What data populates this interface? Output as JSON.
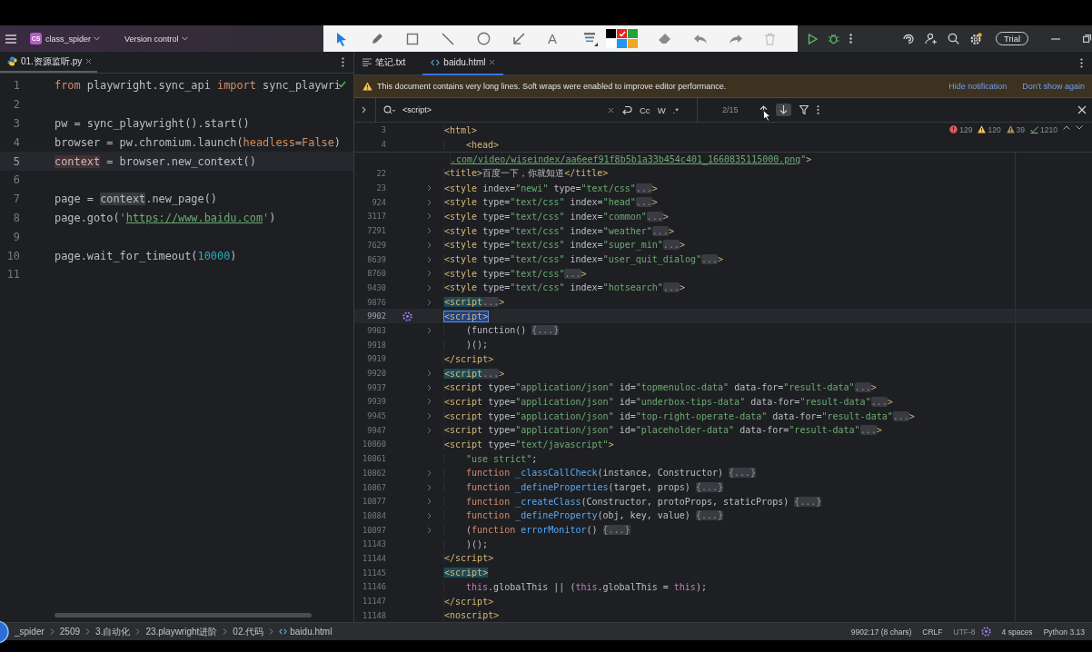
{
  "title_bar": {
    "project_badge": "CS",
    "project": "class_spider",
    "vcs": "Version control",
    "trial": "Trial"
  },
  "annotation_toolbar": {
    "tools": [
      {
        "kind": "pointer",
        "selected": true
      },
      {
        "kind": "pencil",
        "selected": false
      },
      {
        "kind": "rectangle",
        "selected": false
      },
      {
        "kind": "line",
        "selected": false
      },
      {
        "kind": "ellipse",
        "selected": false
      },
      {
        "kind": "arrow",
        "selected": false
      },
      {
        "kind": "text",
        "label": "A",
        "selected": false
      },
      {
        "kind": "stroke",
        "selected": false
      }
    ],
    "palette": [
      {
        "color": "#000000",
        "selected": false
      },
      {
        "color": "#e8231f",
        "selected": true
      },
      {
        "color": "#1fa53a",
        "selected": false
      },
      {
        "color": "#ffffff",
        "selected": false
      },
      {
        "color": "#2196f3",
        "selected": false
      },
      {
        "color": "#f5a623",
        "selected": false
      }
    ],
    "actions": [
      {
        "kind": "eraser",
        "disabled": false
      },
      {
        "kind": "undo",
        "disabled": false
      },
      {
        "kind": "redo",
        "disabled": false
      },
      {
        "kind": "delete",
        "disabled": true
      }
    ]
  },
  "left_editor": {
    "tabs": [
      {
        "label": "01.资源监听.py",
        "selected": true
      }
    ],
    "lines": [
      {
        "number": "1",
        "current": false,
        "tokens": [
          {
            "kind": "kw",
            "text": "from"
          },
          {
            "kind": "plain",
            "text": " playwright.sync_api "
          },
          {
            "kind": "kw",
            "text": "import"
          },
          {
            "kind": "plain",
            "text": " sync_playwri"
          }
        ]
      },
      {
        "number": "2",
        "current": false
      },
      {
        "number": "3",
        "current": false,
        "tokens": [
          {
            "kind": "plain",
            "text": "pw = sync_playwright().start()"
          }
        ]
      },
      {
        "number": "4",
        "current": false,
        "tokens": [
          {
            "kind": "plain",
            "text": "browser = pw.chromium.launch("
          },
          {
            "kind": "param",
            "text": "headless"
          },
          {
            "kind": "plain",
            "text": "="
          },
          {
            "kind": "kw",
            "text": "False"
          },
          {
            "kind": "plain",
            "text": ")"
          }
        ]
      },
      {
        "number": "5",
        "current": true,
        "tokens": [
          {
            "kind": "write",
            "text": "context"
          },
          {
            "kind": "plain",
            "text": " = browser.new_context()"
          }
        ]
      },
      {
        "number": "6",
        "current": false
      },
      {
        "number": "7",
        "current": false,
        "tokens": [
          {
            "kind": "plain",
            "text": "page = "
          },
          {
            "kind": "read",
            "text": "context"
          },
          {
            "kind": "plain",
            "text": ".new_page()"
          }
        ]
      },
      {
        "number": "8",
        "current": false,
        "tokens": [
          {
            "kind": "plain",
            "text": "page.goto("
          },
          {
            "kind": "str",
            "text": "'"
          },
          {
            "kind": "url",
            "text": "https://www.baidu.com"
          },
          {
            "kind": "str",
            "text": "'"
          },
          {
            "kind": "plain",
            "text": ")"
          }
        ]
      },
      {
        "number": "9",
        "current": false
      },
      {
        "number": "10",
        "current": false,
        "tokens": [
          {
            "kind": "plain",
            "text": "page.wait_for_timeout("
          },
          {
            "kind": "num",
            "text": "10000"
          },
          {
            "kind": "plain",
            "text": ")"
          }
        ]
      },
      {
        "number": "11",
        "current": false
      }
    ]
  },
  "right_editor": {
    "tabs": [
      {
        "label": "笔记.txt",
        "kind": "text",
        "selected": false
      },
      {
        "label": "baidu.html",
        "kind": "html",
        "selected": true
      }
    ],
    "notification": {
      "text": "This document contains very long lines. Soft wraps were enabled to improve editor performance.",
      "actions": [
        "Hide notification",
        "Don't show again"
      ]
    },
    "search": {
      "query": "<script>",
      "options": [
        "Cc",
        "W",
        ".*"
      ],
      "match_count": "2/15"
    },
    "inspections": [
      {
        "kind": "error",
        "count": "129"
      },
      {
        "kind": "warning",
        "count": "120"
      },
      {
        "kind": "weak",
        "count": "39"
      },
      {
        "kind": "typo",
        "count": "1210"
      }
    ],
    "sticky_lines": [
      {
        "number": "3",
        "current": false,
        "foldable": false,
        "marked": false,
        "tokens": [
          {
            "kind": "tag",
            "text": "<html>"
          }
        ],
        "children": [
          {
            "number": "4",
            "current": false,
            "foldable": false,
            "marked": false,
            "tokens": [
              {
                "kind": "tag",
                "text": "<head>"
              }
            ]
          }
        ]
      }
    ],
    "lines": [
      {
        "kind": "continuation",
        "current": false,
        "foldable": false,
        "marked": false,
        "tokens": [
          {
            "kind": "url",
            "text": ".com/video/wiseindex/aa6eef91f8b5b1a33b454c401_1660835115000.png"
          },
          {
            "kind": "val",
            "text": "\""
          },
          {
            "kind": "tag",
            "text": ">"
          }
        ]
      },
      {
        "number": "22",
        "current": false,
        "foldable": false,
        "marked": false,
        "tokens": [
          {
            "kind": "tag",
            "text": "<title>"
          },
          {
            "kind": "plain",
            "text": "百度一下，你就知道"
          },
          {
            "kind": "tag",
            "text": "</title>"
          }
        ]
      },
      {
        "number": "23",
        "current": false,
        "foldable": true,
        "marked": false,
        "tokens": [
          {
            "kind": "tag",
            "text": "<style"
          },
          {
            "kind": "attr",
            "text": " index="
          },
          {
            "kind": "val",
            "text": "\"newi\""
          },
          {
            "kind": "attr",
            "text": " type="
          },
          {
            "kind": "val",
            "text": "\"text/css\""
          },
          {
            "kind": "fold",
            "text": "..."
          },
          {
            "kind": "tag",
            "text": ">"
          }
        ]
      },
      {
        "number": "924",
        "current": false,
        "foldable": true,
        "marked": false,
        "tokens": [
          {
            "kind": "tag",
            "text": "<style"
          },
          {
            "kind": "attr",
            "text": " type="
          },
          {
            "kind": "val",
            "text": "\"text/css\""
          },
          {
            "kind": "attr",
            "text": " index="
          },
          {
            "kind": "val",
            "text": "\"head\""
          },
          {
            "kind": "fold",
            "text": "..."
          },
          {
            "kind": "tag",
            "text": ">"
          }
        ]
      },
      {
        "number": "3117",
        "current": false,
        "foldable": true,
        "marked": false,
        "tokens": [
          {
            "kind": "tag",
            "text": "<style"
          },
          {
            "kind": "attr",
            "text": " type="
          },
          {
            "kind": "val",
            "text": "\"text/css\""
          },
          {
            "kind": "attr",
            "text": " index="
          },
          {
            "kind": "val",
            "text": "\"common\""
          },
          {
            "kind": "fold",
            "text": "..."
          },
          {
            "kind": "tag",
            "text": ">"
          }
        ]
      },
      {
        "number": "7291",
        "current": false,
        "foldable": true,
        "marked": false,
        "tokens": [
          {
            "kind": "tag",
            "text": "<style"
          },
          {
            "kind": "attr",
            "text": " type="
          },
          {
            "kind": "val",
            "text": "\"text/css\""
          },
          {
            "kind": "attr",
            "text": " index="
          },
          {
            "kind": "val",
            "text": "\"weather\""
          },
          {
            "kind": "fold",
            "text": "..."
          },
          {
            "kind": "tag",
            "text": ">"
          }
        ]
      },
      {
        "number": "7629",
        "current": false,
        "foldable": true,
        "marked": false,
        "tokens": [
          {
            "kind": "tag",
            "text": "<style"
          },
          {
            "kind": "attr",
            "text": " type="
          },
          {
            "kind": "val",
            "text": "\"text/css\""
          },
          {
            "kind": "attr",
            "text": " index="
          },
          {
            "kind": "val",
            "text": "\"super_min\""
          },
          {
            "kind": "fold",
            "text": "..."
          },
          {
            "kind": "tag",
            "text": ">"
          }
        ]
      },
      {
        "number": "8639",
        "current": false,
        "foldable": true,
        "marked": false,
        "tokens": [
          {
            "kind": "tag",
            "text": "<style"
          },
          {
            "kind": "attr",
            "text": " type="
          },
          {
            "kind": "val",
            "text": "\"text/css\""
          },
          {
            "kind": "attr",
            "text": " index="
          },
          {
            "kind": "val",
            "text": "\"user_quit_dialog\""
          },
          {
            "kind": "fold",
            "text": "..."
          },
          {
            "kind": "tag",
            "text": ">"
          }
        ]
      },
      {
        "number": "8760",
        "current": false,
        "foldable": true,
        "marked": false,
        "tokens": [
          {
            "kind": "tag",
            "text": "<style"
          },
          {
            "kind": "attr",
            "text": " type="
          },
          {
            "kind": "val",
            "text": "\"text/css\""
          },
          {
            "kind": "fold",
            "text": "..."
          },
          {
            "kind": "tag",
            "text": ">"
          }
        ]
      },
      {
        "number": "9430",
        "current": false,
        "foldable": true,
        "marked": false,
        "tokens": [
          {
            "kind": "tag",
            "text": "<style"
          },
          {
            "kind": "attr",
            "text": " type="
          },
          {
            "kind": "val",
            "text": "\"text/css\""
          },
          {
            "kind": "attr",
            "text": " index="
          },
          {
            "kind": "val",
            "text": "\"hotsearch\""
          },
          {
            "kind": "fold",
            "text": "..."
          },
          {
            "kind": "tag",
            "text": ">"
          }
        ]
      },
      {
        "number": "9876",
        "current": false,
        "foldable": true,
        "marked": false,
        "tokens": [
          {
            "kind": "match",
            "text": "<script"
          },
          {
            "kind": "fold",
            "text": "..."
          },
          {
            "kind": "tag",
            "text": ">"
          }
        ]
      },
      {
        "number": "9902",
        "current": true,
        "foldable": false,
        "marked": true,
        "tokens": [
          {
            "kind": "match_current",
            "text": "<script>"
          }
        ],
        "children": [
          {
            "number": "9903",
            "current": false,
            "foldable": true,
            "marked": false,
            "tokens": [
              {
                "kind": "plain",
                "text": "(function() "
              },
              {
                "kind": "fold",
                "text": "{...}"
              }
            ]
          },
          {
            "number": "9918",
            "current": false,
            "foldable": false,
            "marked": false,
            "tokens": [
              {
                "kind": "plain",
                "text": ")();"
              }
            ]
          }
        ]
      },
      {
        "number": "9919",
        "current": false,
        "foldable": false,
        "marked": false,
        "tokens": [
          {
            "kind": "tag",
            "text": "</script>"
          }
        ]
      },
      {
        "number": "9920",
        "current": false,
        "foldable": true,
        "marked": false,
        "tokens": [
          {
            "kind": "match",
            "text": "<script"
          },
          {
            "kind": "fold",
            "text": "..."
          },
          {
            "kind": "tag",
            "text": ">"
          }
        ]
      },
      {
        "number": "9937",
        "current": false,
        "foldable": true,
        "marked": false,
        "tokens": [
          {
            "kind": "tag",
            "text": "<script"
          },
          {
            "kind": "attr",
            "text": " type="
          },
          {
            "kind": "val",
            "text": "\"application/json\""
          },
          {
            "kind": "attr",
            "text": " id="
          },
          {
            "kind": "val",
            "text": "\"topmenuloc-data\""
          },
          {
            "kind": "attr",
            "text": " data-for="
          },
          {
            "kind": "val",
            "text": "\"result-data\""
          },
          {
            "kind": "fold",
            "text": "..."
          },
          {
            "kind": "tag",
            "text": ">"
          }
        ]
      },
      {
        "number": "9939",
        "current": false,
        "foldable": true,
        "marked": false,
        "tokens": [
          {
            "kind": "tag",
            "text": "<script"
          },
          {
            "kind": "attr",
            "text": " type="
          },
          {
            "kind": "val",
            "text": "\"application/json\""
          },
          {
            "kind": "attr",
            "text": " id="
          },
          {
            "kind": "val",
            "text": "\"underbox-tips-data\""
          },
          {
            "kind": "attr",
            "text": " data-for="
          },
          {
            "kind": "val",
            "text": "\"result-data\""
          },
          {
            "kind": "fold",
            "text": "..."
          },
          {
            "kind": "tag",
            "text": ">"
          }
        ]
      },
      {
        "number": "9945",
        "current": false,
        "foldable": true,
        "marked": false,
        "tokens": [
          {
            "kind": "tag",
            "text": "<script"
          },
          {
            "kind": "attr",
            "text": " type="
          },
          {
            "kind": "val",
            "text": "\"application/json\""
          },
          {
            "kind": "attr",
            "text": " id="
          },
          {
            "kind": "val",
            "text": "\"top-right-operate-data\""
          },
          {
            "kind": "attr",
            "text": " data-for="
          },
          {
            "kind": "val",
            "text": "\"result-data\""
          },
          {
            "kind": "fold",
            "text": "..."
          },
          {
            "kind": "tag",
            "text": ">"
          }
        ]
      },
      {
        "number": "9947",
        "current": false,
        "foldable": true,
        "marked": false,
        "tokens": [
          {
            "kind": "tag",
            "text": "<script"
          },
          {
            "kind": "attr",
            "text": " type="
          },
          {
            "kind": "val",
            "text": "\"application/json\""
          },
          {
            "kind": "attr",
            "text": " id="
          },
          {
            "kind": "val",
            "text": "\"placeholder-data\""
          },
          {
            "kind": "attr",
            "text": " data-for="
          },
          {
            "kind": "val",
            "text": "\"result-data\""
          },
          {
            "kind": "fold",
            "text": "..."
          },
          {
            "kind": "tag",
            "text": ">"
          }
        ]
      },
      {
        "number": "10860",
        "current": false,
        "foldable": false,
        "marked": false,
        "tokens": [
          {
            "kind": "tag",
            "text": "<script"
          },
          {
            "kind": "attr",
            "text": " type="
          },
          {
            "kind": "val",
            "text": "\"text/javascript\""
          },
          {
            "kind": "tag",
            "text": ">"
          }
        ],
        "children": [
          {
            "number": "10861",
            "current": false,
            "foldable": false,
            "marked": false,
            "tokens": [
              {
                "kind": "val",
                "text": "\"use strict\""
              },
              {
                "kind": "plain",
                "text": ";"
              }
            ]
          },
          {
            "number": "10862",
            "current": false,
            "foldable": true,
            "marked": false,
            "tokens": [
              {
                "kind": "kw",
                "text": "function "
              },
              {
                "kind": "fn",
                "text": "_classCallCheck"
              },
              {
                "kind": "plain",
                "text": "(instance, Constructor) "
              },
              {
                "kind": "fold",
                "text": "{...}"
              }
            ]
          },
          {
            "number": "10867",
            "current": false,
            "foldable": true,
            "marked": false,
            "tokens": [
              {
                "kind": "kw",
                "text": "function "
              },
              {
                "kind": "fn",
                "text": "_defineProperties"
              },
              {
                "kind": "plain",
                "text": "(target, props) "
              },
              {
                "kind": "fold",
                "text": "{...}"
              }
            ]
          },
          {
            "number": "10877",
            "current": false,
            "foldable": true,
            "marked": false,
            "tokens": [
              {
                "kind": "kw",
                "text": "function "
              },
              {
                "kind": "fn",
                "text": "_createClass"
              },
              {
                "kind": "plain",
                "text": "(Constructor, protoProps, staticProps) "
              },
              {
                "kind": "fold",
                "text": "{...}"
              }
            ]
          },
          {
            "number": "10884",
            "current": false,
            "foldable": true,
            "marked": false,
            "tokens": [
              {
                "kind": "kw",
                "text": "function "
              },
              {
                "kind": "fn",
                "text": "_defineProperty"
              },
              {
                "kind": "plain",
                "text": "(obj, key, value) "
              },
              {
                "kind": "fold",
                "text": "{...}"
              }
            ]
          },
          {
            "number": "10897",
            "current": false,
            "foldable": true,
            "marked": false,
            "tokens": [
              {
                "kind": "plain",
                "text": "("
              },
              {
                "kind": "kw",
                "text": "function "
              },
              {
                "kind": "fn",
                "text": "errorMonitor"
              },
              {
                "kind": "plain",
                "text": "() "
              },
              {
                "kind": "fold",
                "text": "{...}"
              }
            ]
          },
          {
            "number": "11143",
            "current": false,
            "foldable": false,
            "marked": false,
            "tokens": [
              {
                "kind": "plain",
                "text": ")();"
              }
            ]
          }
        ]
      },
      {
        "number": "11144",
        "current": false,
        "foldable": false,
        "marked": false,
        "tokens": [
          {
            "kind": "tag",
            "text": "</script>"
          }
        ]
      },
      {
        "number": "11145",
        "current": false,
        "foldable": false,
        "marked": false,
        "tokens": [
          {
            "kind": "match",
            "text": "<script>"
          }
        ],
        "children": [
          {
            "number": "11146",
            "current": false,
            "foldable": false,
            "marked": false,
            "tokens": [
              {
                "kind": "this",
                "text": "this"
              },
              {
                "kind": "plain",
                "text": ".globalThis || ("
              },
              {
                "kind": "this",
                "text": "this"
              },
              {
                "kind": "plain",
                "text": ".globalThis = "
              },
              {
                "kind": "this",
                "text": "this"
              },
              {
                "kind": "plain",
                "text": ");"
              }
            ]
          }
        ]
      },
      {
        "number": "11147",
        "current": false,
        "foldable": false,
        "marked": false,
        "tokens": [
          {
            "kind": "tag",
            "text": "</script>"
          }
        ]
      },
      {
        "number": "11148",
        "current": false,
        "foldable": false,
        "marked": false,
        "tokens": [
          {
            "kind": "tag",
            "text": "<noscript>"
          }
        ]
      }
    ]
  },
  "status_bar": {
    "breadcrumbs": [
      {
        "label": "_spider",
        "kind": "folder"
      },
      {
        "label": "2509",
        "kind": "folder"
      },
      {
        "label": "3.自动化",
        "kind": "folder"
      },
      {
        "label": "23.playwright进阶",
        "kind": "folder"
      },
      {
        "label": "02.代码",
        "kind": "folder"
      },
      {
        "label": "baidu.html",
        "kind": "html"
      }
    ],
    "position": "9902:17 (8 chars)",
    "line_separator": "CRLF",
    "encoding": "UTF-8",
    "indent": "4 spaces",
    "interpreter": "Python 3.13"
  }
}
